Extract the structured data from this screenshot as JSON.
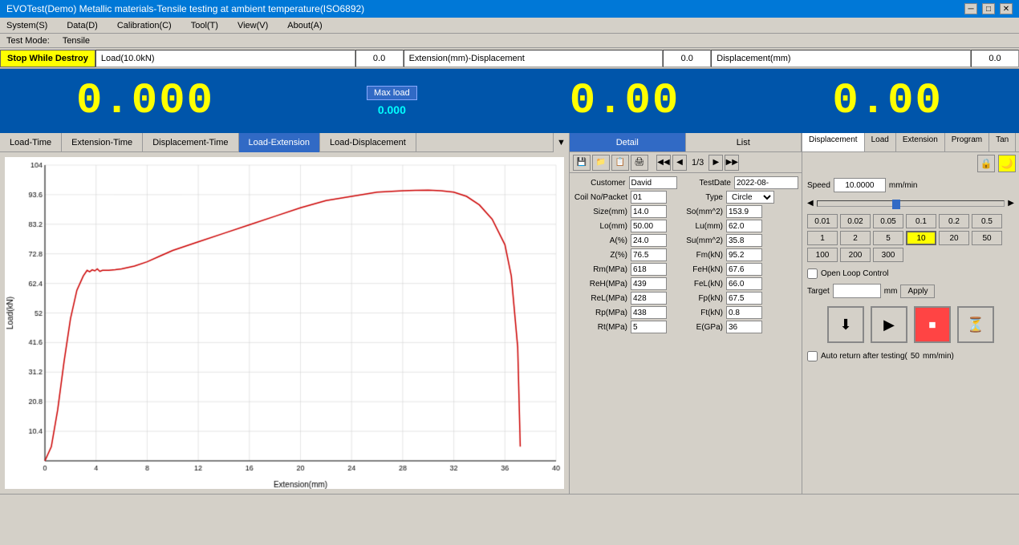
{
  "title_bar": {
    "title": "EVOTest(Demo) Metallic materials-Tensile testing at ambient temperature(ISO6892)",
    "min": "─",
    "max": "□",
    "close": "✕"
  },
  "menu": {
    "items": [
      "System(S)",
      "Data(D)",
      "Calibration(C)",
      "Tool(T)",
      "View(V)",
      "About(A)"
    ]
  },
  "mode_bar": {
    "test_mode_label": "Test Mode:",
    "test_mode_value": "Tensile"
  },
  "status_bar": {
    "stop_btn": "Stop While Destroy",
    "load_label": "Load(10.0kN)",
    "load_value": "0.0",
    "ext_label": "Extension(mm)-Displacement",
    "ext_value": "0.0",
    "disp_label": "Displacement(mm)",
    "disp_value": "0.0"
  },
  "big_display": {
    "load_num": "0.000",
    "ext_num": "0.00",
    "disp_num": "0.00",
    "max_load_btn": "Max load",
    "small_value": "0.000"
  },
  "tabs": {
    "items": [
      "Load-Time",
      "Extension-Time",
      "Displacement-Time",
      "Load-Extension",
      "Load-Displacement"
    ],
    "active": 3
  },
  "chart": {
    "x_label": "Extension(mm)",
    "x_max": 40,
    "y_label": "Load(kN)",
    "y_ticks": [
      10.4,
      20.8,
      31.2,
      41.6,
      52,
      62.4,
      72.8,
      83.2,
      93.6,
      104
    ]
  },
  "detail_tabs": {
    "items": [
      "Detail",
      "List"
    ],
    "active": 0
  },
  "detail_toolbar": {
    "icons": [
      "💾",
      "📁",
      "📋",
      "🖨"
    ],
    "nav_first": "◀◀",
    "nav_prev": "◀",
    "page": "1/3",
    "nav_next": "▶",
    "nav_last": "▶▶"
  },
  "form": {
    "customer_label": "Customer",
    "customer_value": "David",
    "test_date_label": "TestDate",
    "test_date_value": "2022-08-",
    "coil_no_label": "Coil No/Packet",
    "coil_no_value": "01",
    "type_label": "Type",
    "type_value": "Circle",
    "size_label": "Size(mm)",
    "size_value": "14.0",
    "so_label": "So(mm^2)",
    "so_value": "153.9",
    "lo_label": "Lo(mm)",
    "lo_value": "50.00",
    "lu_label": "Lu(mm)",
    "lu_value": "62.0",
    "a_label": "A(%)",
    "a_value": "24.0",
    "su_label": "Su(mm^2)",
    "su_value": "35.8",
    "z_label": "Z(%)",
    "z_value": "76.5",
    "fm_label": "Fm(kN)",
    "fm_value": "95.2",
    "rm_label": "Rm(MPa)",
    "rm_value": "618",
    "feh_label": "FeH(kN)",
    "feh_value": "67.6",
    "reh_label": "ReH(MPa)",
    "reh_value": "439",
    "fel_label": "FeL(kN)",
    "fel_value": "66.0",
    "rel_label": "ReL(MPa)",
    "rel_value": "428",
    "fp_label": "Fp(kN)",
    "fp_value": "67.5",
    "rp_label": "Rp(MPa)",
    "rp_value": "438",
    "ft_label": "Ft(kN)",
    "ft_value": "0.8",
    "rt_label": "Rt(MPa)",
    "rt_value": "5",
    "e_label": "E(GPa)",
    "e_value": "36"
  },
  "far_right": {
    "tabs": [
      "Displacement",
      "Load",
      "Extension",
      "Program",
      "Tan"
    ],
    "active": 0,
    "lock_icon": "🔒",
    "yellow_icon": "🌙",
    "speed_label": "Speed",
    "speed_value": "10.0000",
    "speed_unit": "mm/min",
    "speed_values": [
      "0.01",
      "0.02",
      "0.05",
      "0.1",
      "0.2",
      "0.5",
      "1",
      "2",
      "5",
      "10",
      "20",
      "50",
      "100",
      "200",
      "300"
    ],
    "selected_speed": "10",
    "open_loop_label": "Open Loop Control",
    "target_label": "Target",
    "target_value": "",
    "target_unit": "mm",
    "apply_btn": "Apply",
    "auto_return_label": "Auto return after testing(",
    "auto_return_value": "50",
    "auto_return_unit": "mm/min)",
    "ctrl_btns": [
      "⬇",
      "▶",
      "⏹",
      "⏳"
    ]
  }
}
